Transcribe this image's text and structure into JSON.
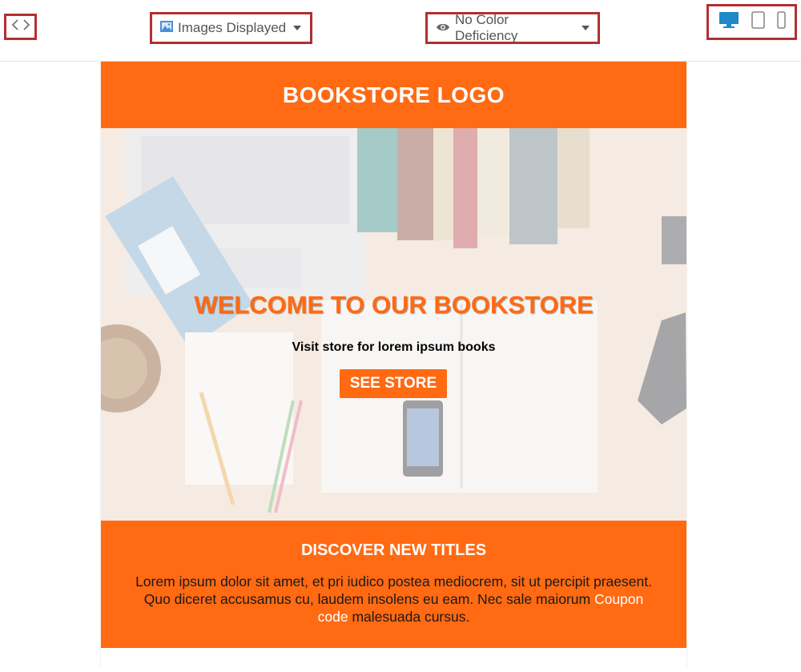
{
  "toolbar": {
    "code_icon": "code-brackets-icon",
    "images_dropdown": {
      "icon": "image-icon",
      "label": "Images Displayed"
    },
    "color_dropdown": {
      "icon": "eye-icon",
      "label": "No Color Deficiency"
    },
    "devices": [
      {
        "name": "desktop",
        "icon": "desktop-icon",
        "active": true
      },
      {
        "name": "tablet",
        "icon": "tablet-icon",
        "active": false
      },
      {
        "name": "mobile",
        "icon": "mobile-icon",
        "active": false
      }
    ],
    "colors": {
      "highlight_border": "#b23030",
      "active_device": "#1e88c9",
      "inactive_device": "#8a8a8a"
    }
  },
  "email": {
    "logo_text": "BOOKSTORE LOGO",
    "hero": {
      "title": "WELCOME TO OUR BOOKSTORE",
      "subtitle": "Visit store for lorem ipsum books",
      "button_label": "SEE STORE"
    },
    "discover": {
      "heading": "DISCOVER NEW TITLES",
      "body_before": "Lorem ipsum dolor sit amet, et pri iudico postea mediocrem, sit ut percipit praesent. Quo diceret accusamus cu, laudem insolens eu eam. Nec sale maiorum",
      "link_text": "Coupon code",
      "body_after": "malesuada cursus."
    },
    "colors": {
      "brand_orange": "#ff6a13",
      "text_dark": "#1a1a1a",
      "white": "#ffffff"
    }
  }
}
